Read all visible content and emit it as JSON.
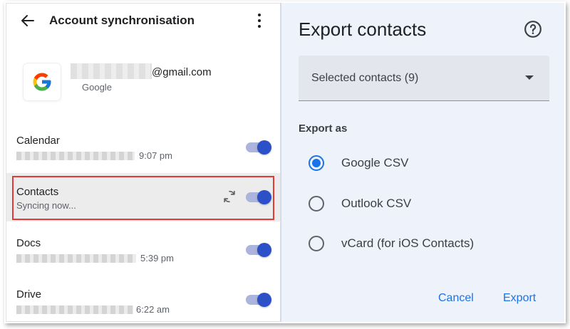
{
  "sync_panel": {
    "title": "Account synchronisation",
    "account": {
      "email_domain": "@gmail.com",
      "provider": "Google"
    },
    "items": [
      {
        "label": "Calendar",
        "time": "9:07 pm",
        "enabled": true
      },
      {
        "label": "Contacts",
        "status": "Syncing now...",
        "enabled": true,
        "highlighted": true
      },
      {
        "label": "Docs",
        "time": "5:39 pm",
        "enabled": true
      },
      {
        "label": "Drive",
        "time": "6:22 am",
        "enabled": true
      }
    ],
    "colors": {
      "toggle_accent": "#2b50c8",
      "highlight": "#e53935"
    }
  },
  "export_dialog": {
    "title": "Export contacts",
    "help_icon": "help-circle-icon",
    "selection": "Selected contacts (9)",
    "export_as_label": "Export as",
    "options": [
      {
        "label": "Google CSV",
        "selected": true
      },
      {
        "label": "Outlook CSV",
        "selected": false
      },
      {
        "label": "vCard (for iOS Contacts)",
        "selected": false
      }
    ],
    "cancel_label": "Cancel",
    "export_label": "Export",
    "colors": {
      "accent": "#1a73e8",
      "background": "#eef2fb"
    }
  }
}
